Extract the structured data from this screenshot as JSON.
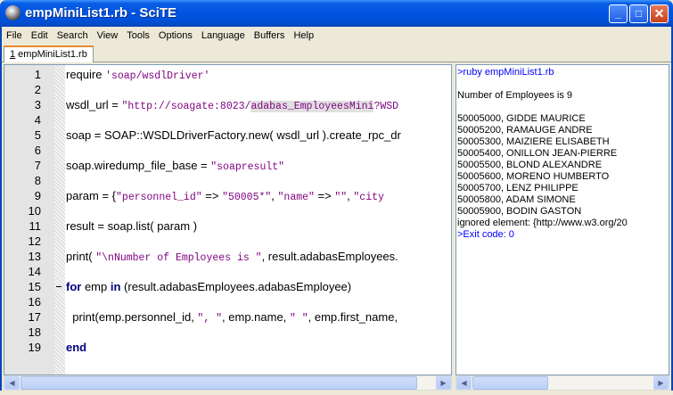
{
  "window": {
    "title": "empMiniList1.rb - SciTE",
    "minimize_glyph": "_",
    "maximize_glyph": "□",
    "close_glyph": "✕"
  },
  "menu": [
    "File",
    "Edit",
    "Search",
    "View",
    "Tools",
    "Options",
    "Language",
    "Buffers",
    "Help"
  ],
  "tab": {
    "number": "1",
    "label": " empMiniList1.rb"
  },
  "editor": {
    "lines": [
      {
        "n": "1",
        "parts": [
          [
            "t",
            "require "
          ],
          [
            "s",
            "'soap/wsdlDriver'"
          ]
        ]
      },
      {
        "n": "2",
        "parts": []
      },
      {
        "n": "3",
        "parts": [
          [
            "t",
            "wsdl_url = "
          ],
          [
            "s",
            "\"http://soagate:8023/"
          ],
          [
            "h",
            "adabas_EmployeesMini"
          ],
          [
            "s",
            "?WSD"
          ]
        ]
      },
      {
        "n": "4",
        "parts": []
      },
      {
        "n": "5",
        "parts": [
          [
            "t",
            "soap = SOAP::WSDLDriverFactory.new( wsdl_url ).create_rpc_dr"
          ]
        ]
      },
      {
        "n": "6",
        "parts": []
      },
      {
        "n": "7",
        "parts": [
          [
            "t",
            "soap.wiredump_file_base = "
          ],
          [
            "s",
            "\"soapresult\""
          ]
        ]
      },
      {
        "n": "8",
        "parts": []
      },
      {
        "n": "9",
        "parts": [
          [
            "t",
            "param = {"
          ],
          [
            "s",
            "\"personnel_id\""
          ],
          [
            "t",
            " => "
          ],
          [
            "s",
            "\"50005*\""
          ],
          [
            "t",
            ", "
          ],
          [
            "s",
            "\"name\""
          ],
          [
            "t",
            " => "
          ],
          [
            "s",
            "\"\""
          ],
          [
            "t",
            ", "
          ],
          [
            "s",
            "\"city"
          ]
        ]
      },
      {
        "n": "10",
        "parts": []
      },
      {
        "n": "11",
        "parts": [
          [
            "t",
            "result = soap.list( param )"
          ]
        ]
      },
      {
        "n": "12",
        "parts": []
      },
      {
        "n": "13",
        "parts": [
          [
            "t",
            "print( "
          ],
          [
            "s",
            "\"\\nNumber of Employees is \""
          ],
          [
            "t",
            ", result.adabasEmployees."
          ]
        ]
      },
      {
        "n": "14",
        "parts": []
      },
      {
        "n": "15",
        "fold": true,
        "parts": [
          [
            "k",
            "for"
          ],
          [
            "t",
            " emp "
          ],
          [
            "k",
            "in"
          ],
          [
            "t",
            " (result.adabasEmployees.adabasEmployee)"
          ]
        ]
      },
      {
        "n": "16",
        "parts": []
      },
      {
        "n": "17",
        "parts": [
          [
            "t",
            "  print(emp.personnel_id, "
          ],
          [
            "s",
            "\", \""
          ],
          [
            "t",
            ", emp.name, "
          ],
          [
            "s",
            "\" \""
          ],
          [
            "t",
            ", emp.first_name,"
          ]
        ]
      },
      {
        "n": "18",
        "parts": []
      },
      {
        "n": "19",
        "parts": [
          [
            "k",
            "end"
          ]
        ]
      }
    ]
  },
  "output": {
    "lines": [
      {
        "text": ">ruby empMiniList1.rb",
        "blue": true
      },
      {
        "text": ""
      },
      {
        "text": "Number of Employees is 9"
      },
      {
        "text": ""
      },
      {
        "text": "50005000, GIDDE MAURICE"
      },
      {
        "text": "50005200, RAMAUGE ANDRE"
      },
      {
        "text": "50005300, MAIZIERE ELISABETH"
      },
      {
        "text": "50005400, ONILLON JEAN-PIERRE"
      },
      {
        "text": "50005500, BLOND ALEXANDRE"
      },
      {
        "text": "50005600, MORENO HUMBERTO"
      },
      {
        "text": "50005700, LENZ PHILIPPE"
      },
      {
        "text": "50005800, ADAM SIMONE"
      },
      {
        "text": "50005900, BODIN GASTON"
      },
      {
        "text": "ignored element: {http://www.w3.org/20"
      },
      {
        "text": ">Exit code: 0",
        "blue": true
      }
    ]
  },
  "colors": {
    "string": "#7f007f",
    "keyword": "#00007f",
    "output_command": "#0000ff",
    "titlebar": "#0054e3"
  },
  "icons": {
    "app": "scite-app-icon",
    "scroll_left": "◀",
    "scroll_right": "▶"
  }
}
